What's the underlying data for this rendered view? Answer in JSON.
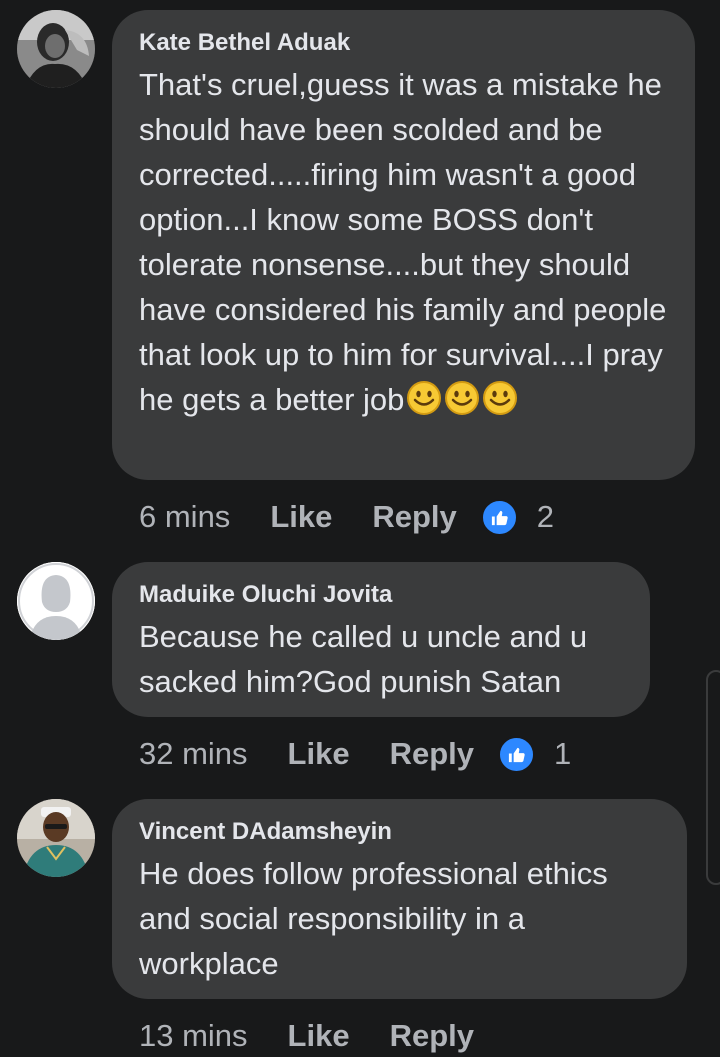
{
  "comments": [
    {
      "author": "Kate Bethel Aduak",
      "text": "That's cruel,guess it was a mistake he should have been scolded and be corrected.....firing him wasn't a good option...I know some BOSS don't tolerate nonsense....but they should have considered his family and people that look up to him for survival....I pray he gets a better job",
      "emojis": [
        "smiling-face-emoji",
        "smiling-face-emoji",
        "smiling-face-emoji"
      ],
      "time": "6 mins",
      "like_label": "Like",
      "reply_label": "Reply",
      "reaction_count": "2",
      "avatar_icon": "profile-photo-avatar"
    },
    {
      "author": "Maduike Oluchi Jovita",
      "text": "Because he called u uncle and u sacked him?God punish Satan",
      "time": "32 mins",
      "like_label": "Like",
      "reply_label": "Reply",
      "reaction_count": "1",
      "avatar_icon": "default-female-avatar"
    },
    {
      "author": "Vincent DAdamsheyin",
      "text": "He does follow professional ethics and social responsibility in a workplace",
      "time": "13 mins",
      "like_label": "Like",
      "reply_label": "Reply",
      "avatar_icon": "profile-photo-avatar"
    }
  ],
  "colors": {
    "background": "#18191a",
    "bubble": "#3a3b3c",
    "primary_text": "#e4e6eb",
    "secondary_text": "#b0b3b8",
    "like_blue": "#2d88ff"
  }
}
